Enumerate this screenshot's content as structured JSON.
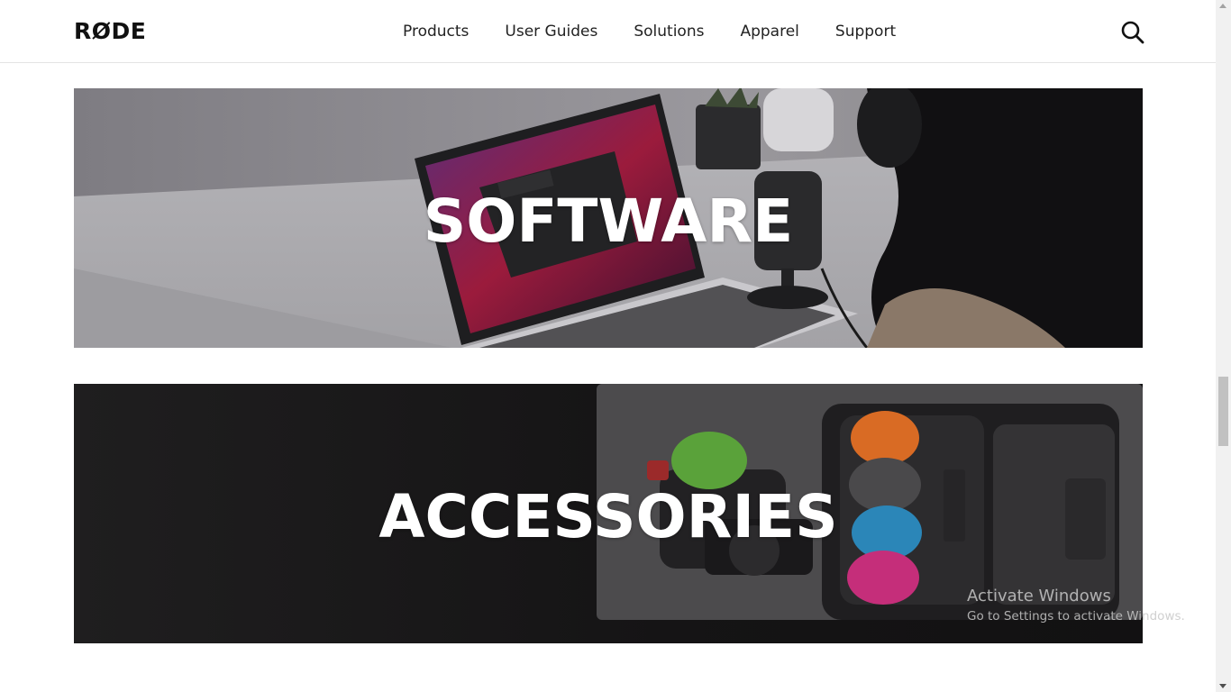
{
  "header": {
    "logo": "RØDE",
    "nav": [
      "Products",
      "User Guides",
      "Solutions",
      "Apparel",
      "Support"
    ],
    "search_icon": "search-icon"
  },
  "banners": [
    {
      "title": "SOFTWARE"
    },
    {
      "title": "ACCESSORIES"
    }
  ],
  "watermark": {
    "title": "Activate Windows",
    "subtitle": "Go to Settings to activate Windows."
  }
}
